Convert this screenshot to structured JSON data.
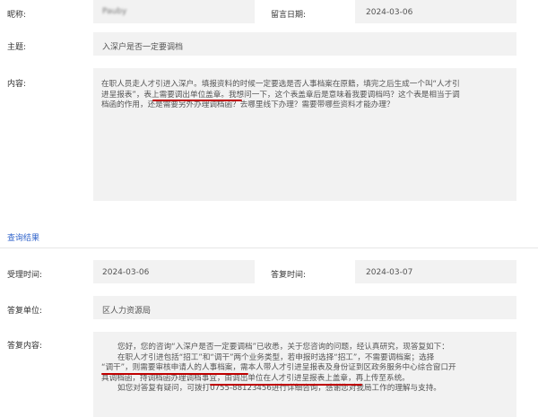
{
  "inquiry": {
    "nickname_label": "昵称:",
    "nickname_value": "Pauby",
    "date_label": "留言日期:",
    "date_value": "2024-03-06",
    "subject_label": "主题:",
    "subject_value": "入深户是否一定要调档",
    "content_label": "内容:",
    "content_lines": [
      "在职人员走人才引进入深户。填报资料的时候一定要选是否人事档案在原籍，填完之后生成一个叫“人才引",
      "进呈报表”，表上需要调出单位盖章。我想问一下，这个表盖章后是意味着我要调档吗？这个表是相当于调",
      "档函的作用，还是需要另外办理调档函？去哪里线下办理？需要带哪些资料才能办理？"
    ]
  },
  "result": {
    "section_title": "查询结果",
    "accept_time_label": "受理时间:",
    "accept_time_value": "2024-03-06",
    "reply_time_label": "答复时间:",
    "reply_time_value": "2024-03-07",
    "reply_unit_label": "答复单位:",
    "reply_unit_value": "区人力资源局",
    "reply_content_label": "答复内容:",
    "reply_lines": [
      "您好，您的咨询“入深户是否一定要调档”已收悉，关于您咨询的问题，经认真研究，现答复如下：",
      "在职人才引进包括“招工”和“调干”两个业务类型，若申报时选择“招工”，不需要调档案；选择",
      "“调干”，则需要审核申请人的人事档案，需本人带人才引进呈报表及身份证到区政务服务中心综合窗口开",
      "具调档函，持调档函办理调档事宜，由调出单位在人才引进呈报表上盖章，再上传至系统。",
      "如您对答复有疑问，可拨打0755-88123456进行详细咨询，感谢您对我局工作的理解与支持。"
    ]
  },
  "colors": {
    "accent": "#3366cc",
    "highlight": "#c00000",
    "field_bg": "#f2f2f2"
  }
}
